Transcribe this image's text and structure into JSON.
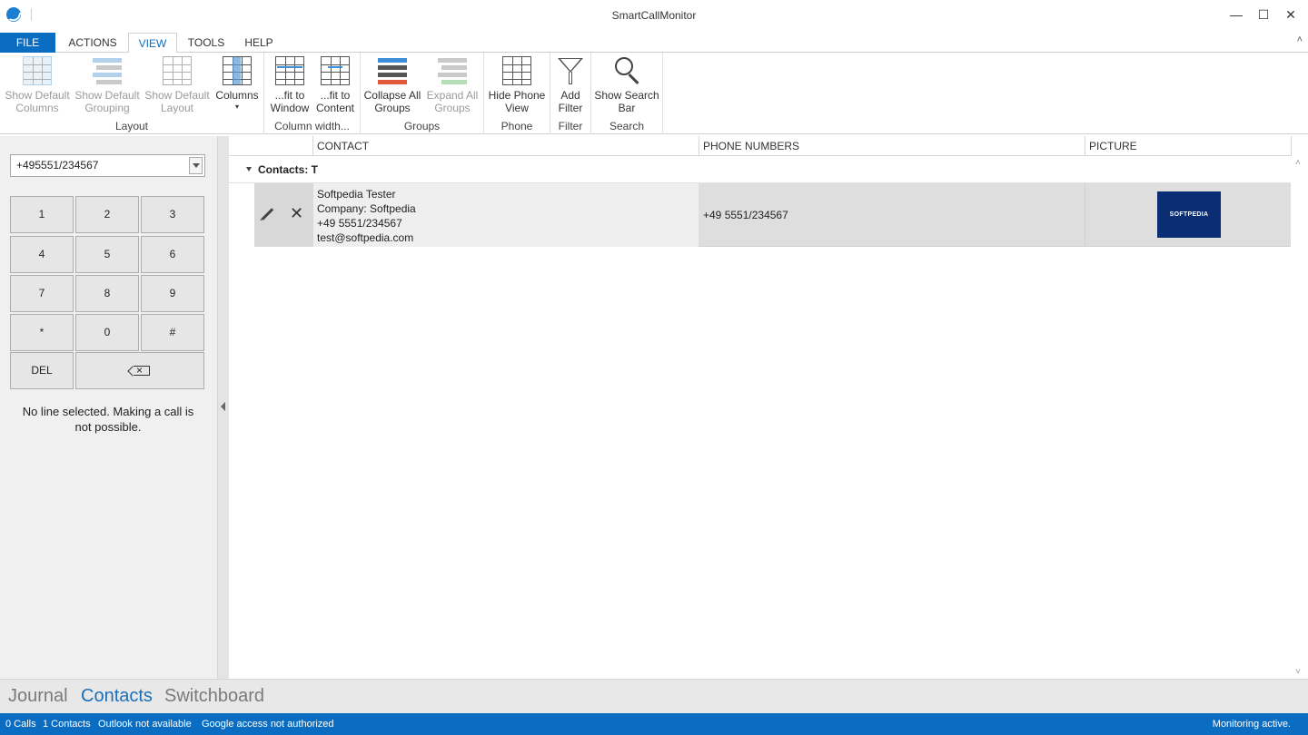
{
  "window": {
    "title": "SmartCallMonitor",
    "controls": {
      "minimize": "—",
      "maximize": "☐",
      "close": "✕"
    }
  },
  "ribbon_tabs": [
    {
      "label": "FILE"
    },
    {
      "label": "ACTIONS"
    },
    {
      "label": "VIEW"
    },
    {
      "label": "TOOLS"
    },
    {
      "label": "HELP"
    }
  ],
  "ribbon_collapse": "˄",
  "ribbon": {
    "layout": {
      "label": "Layout",
      "show_default_columns": "Show Default Columns",
      "show_default_grouping": "Show Default Grouping",
      "show_default_layout": "Show Default Layout",
      "columns": "Columns",
      "columns_arrow": "▾"
    },
    "column_width": {
      "label": "Column width...",
      "fit_window": "...fit to Window",
      "fit_content": "...fit to Content"
    },
    "groups": {
      "label": "Groups",
      "collapse_all": "Collapse All Groups",
      "expand_all": "Expand All Groups"
    },
    "phone": {
      "label": "Phone",
      "hide_phone_view": "Hide Phone View"
    },
    "filter": {
      "label": "Filter",
      "add_filter": "Add Filter"
    },
    "search": {
      "label": "Search",
      "show_search_bar": "Show Search Bar"
    }
  },
  "dialer": {
    "number": "+495551/234567",
    "keys": [
      "1",
      "2",
      "3",
      "4",
      "5",
      "6",
      "7",
      "8",
      "9",
      "*",
      "0",
      "#"
    ],
    "del": "DEL",
    "message": "No line selected. Making a call is not possible."
  },
  "grid": {
    "columns": [
      "CONTACT",
      "PHONE NUMBERS",
      "PICTURE"
    ],
    "group_label": "Contacts: T",
    "rows": [
      {
        "contact_name": "Softpedia Tester",
        "company": "Company: Softpedia",
        "phone": "+49 5551/234567",
        "email": "test@softpedia.com",
        "phone_numbers": "+49 5551/234567",
        "picture_text": "SOFTPEDIA"
      }
    ]
  },
  "bottom_nav": [
    "Journal",
    "Contacts",
    "Switchboard"
  ],
  "status": {
    "calls": "0 Calls",
    "contacts": "1 Contacts",
    "outlook": "Outlook not available",
    "google": "Google access not authorized",
    "monitoring": "Monitoring active."
  },
  "colors": {
    "accent": "#0a6dc2",
    "nav_active": "#1a6fb8",
    "logo_bg": "#0b2d73"
  }
}
